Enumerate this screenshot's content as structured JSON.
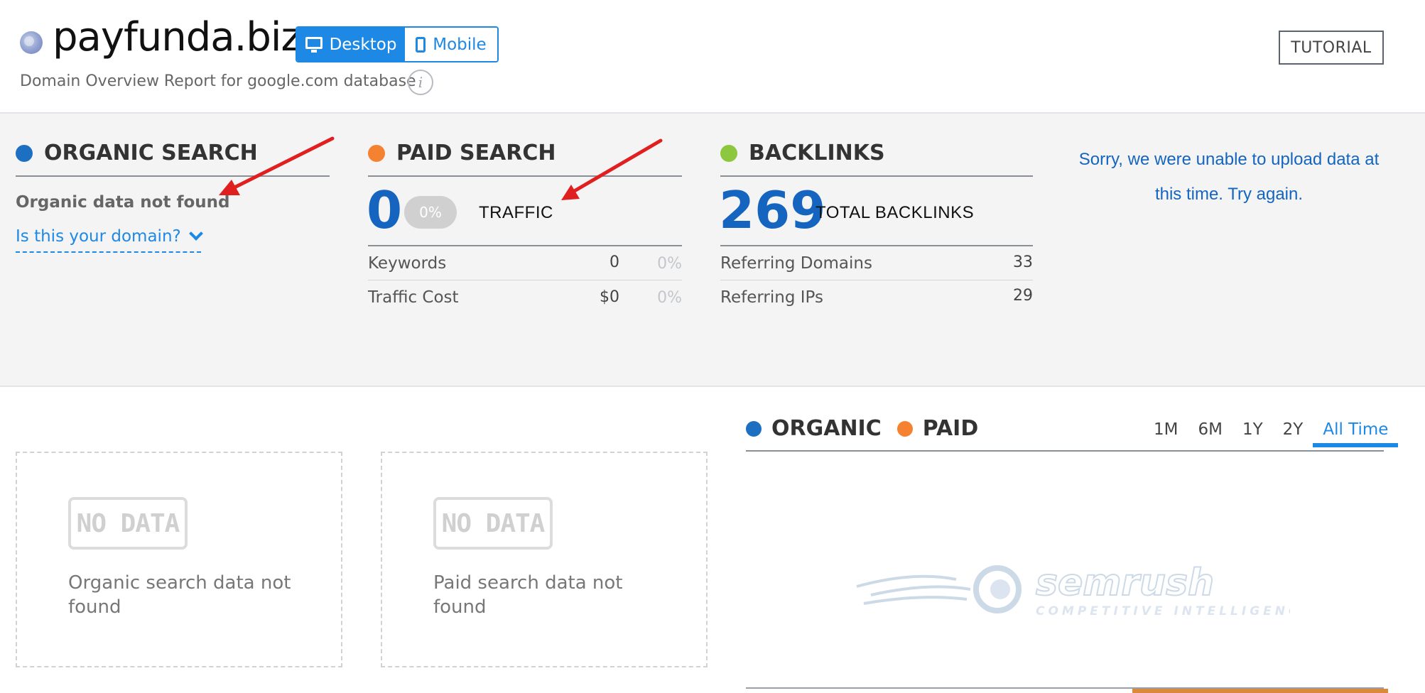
{
  "header": {
    "domain": "payfunda.biz",
    "device_toggle": {
      "desktop_label": "Desktop",
      "mobile_label": "Mobile",
      "selected": "Desktop"
    },
    "subtitle": "Domain Overview Report for google.com database",
    "info_glyph": "i",
    "tutorial_label": "TUTORIAL"
  },
  "organic_search": {
    "title": "ORGANIC SEARCH",
    "not_found": "Organic data not found",
    "domain_link": "Is this your domain?"
  },
  "paid_search": {
    "title": "PAID SEARCH",
    "traffic_value": "0",
    "traffic_pct": "0%",
    "traffic_label": "TRAFFIC",
    "rows": [
      {
        "label": "Keywords",
        "value": "0",
        "pct": "0%"
      },
      {
        "label": "Traffic Cost",
        "value": "$0",
        "pct": "0%"
      }
    ]
  },
  "backlinks": {
    "title": "BACKLINKS",
    "total_value": "269",
    "total_label": "TOTAL BACKLINKS",
    "rows": [
      {
        "label": "Referring Domains",
        "value": "33"
      },
      {
        "label": "Referring IPs",
        "value": "29"
      }
    ]
  },
  "error_message": "Sorry, we were unable to upload data at this time. Try again.",
  "lower": {
    "organic_box": {
      "badge": "NO DATA",
      "text": "Organic search data not found"
    },
    "paid_box": {
      "badge": "NO DATA",
      "text": "Paid search data not found"
    },
    "chart": {
      "legend": [
        "ORGANIC",
        "PAID"
      ],
      "ranges": [
        "1M",
        "6M",
        "1Y",
        "2Y",
        "All Time"
      ],
      "selected_range": "All Time",
      "watermark_brand": "semrush",
      "watermark_tagline": "COMPETITIVE INTELLIGENCE"
    }
  },
  "colors": {
    "accent_blue": "#1e88e5",
    "organic_blue": "#1d6fc2",
    "paid_orange": "#f58231",
    "backlinks_green": "#8dc63f",
    "annotation_red": "#e02020"
  },
  "icons": [
    "globe-icon",
    "desktop-icon",
    "mobile-icon",
    "info-icon",
    "chevron-down-icon",
    "annotation-arrow"
  ]
}
